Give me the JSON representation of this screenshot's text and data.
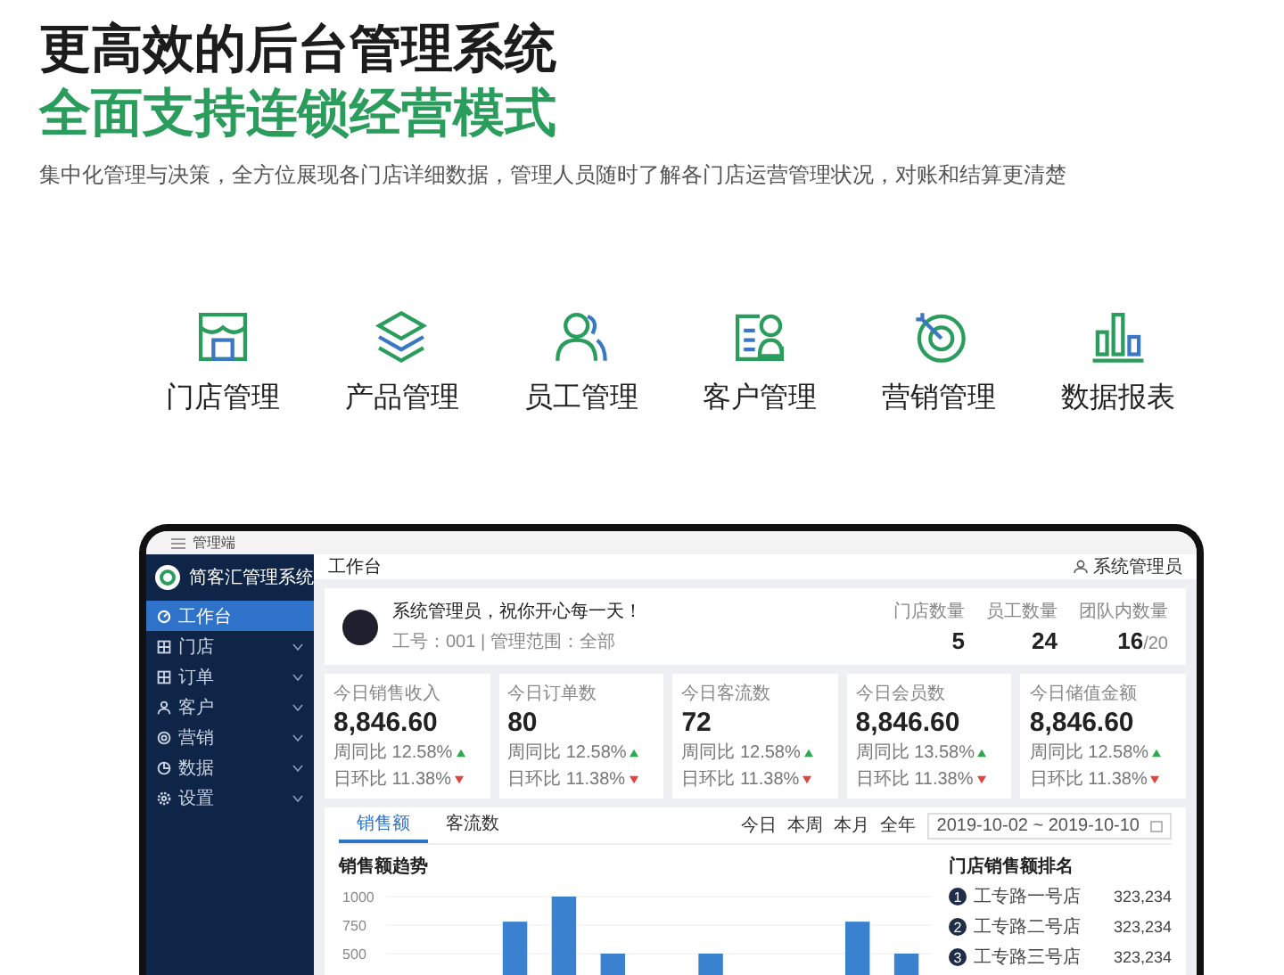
{
  "hero": {
    "title": "更高效的后台管理系统",
    "subtitle": "全面支持连锁经营模式",
    "description": "集中化管理与决策，全方位展现各门店详细数据，管理人员随时了解各门店运营管理状况，对账和结算更清楚"
  },
  "features": [
    {
      "label": "门店管理",
      "kind": "store"
    },
    {
      "label": "产品管理",
      "kind": "layers"
    },
    {
      "label": "员工管理",
      "kind": "people"
    },
    {
      "label": "客户管理",
      "kind": "card"
    },
    {
      "label": "营销管理",
      "kind": "target"
    },
    {
      "label": "数据报表",
      "kind": "bars"
    }
  ],
  "app": {
    "window_title": "管理端",
    "brand": "简客汇管理系统",
    "page_title": "工作台",
    "user": "系统管理员",
    "sidebar": [
      {
        "label": "工作台",
        "kind": "dashboard",
        "selected": true,
        "expandable": false
      },
      {
        "label": "门店",
        "kind": "grid",
        "selected": false,
        "expandable": true
      },
      {
        "label": "订单",
        "kind": "grid",
        "selected": false,
        "expandable": true
      },
      {
        "label": "客户",
        "kind": "person",
        "selected": false,
        "expandable": true
      },
      {
        "label": "营销",
        "kind": "target",
        "selected": false,
        "expandable": true
      },
      {
        "label": "数据",
        "kind": "pie",
        "selected": false,
        "expandable": true
      },
      {
        "label": "设置",
        "kind": "gear",
        "selected": false,
        "expandable": true
      }
    ],
    "greeting": "系统管理员，祝你开心每一天！",
    "meta": "工号：001 | 管理范围：全部",
    "stats": [
      {
        "label": "门店数量",
        "value": "5"
      },
      {
        "label": "员工数量",
        "value": "24"
      },
      {
        "label": "团队内数量",
        "value": "16",
        "suffix": "/20"
      }
    ],
    "kpis": [
      {
        "label": "今日销售收入",
        "value": "8,846.60",
        "week_label": "周同比",
        "week": "12.58%",
        "week_rising": true,
        "day_label": "日环比",
        "day": "11.38%",
        "day_rising": false
      },
      {
        "label": "今日订单数",
        "value": "80",
        "week_label": "周同比",
        "week": "12.58%",
        "week_rising": true,
        "day_label": "日环比",
        "day": "11.38%",
        "day_rising": false
      },
      {
        "label": "今日客流数",
        "value": "72",
        "week_label": "周同比",
        "week": "12.58%",
        "week_rising": true,
        "day_label": "日环比",
        "day": "11.38%",
        "day_rising": false
      },
      {
        "label": "今日会员数",
        "value": "8,846.60",
        "week_label": "周同比",
        "week": "13.58%",
        "week_rising": true,
        "day_label": "日环比",
        "day": "11.38%",
        "day_rising": false
      },
      {
        "label": "今日储值金额",
        "value": "8,846.60",
        "week_label": "周同比",
        "week": "12.58%",
        "week_rising": true,
        "day_label": "日环比",
        "day": "11.38%",
        "day_rising": false
      }
    ],
    "sales": {
      "tabs": [
        {
          "label": "销售额",
          "selected": true
        },
        {
          "label": "客流数",
          "selected": false
        }
      ],
      "ranges": [
        "今日",
        "本周",
        "本月",
        "全年"
      ],
      "date_range": "2019-10-02 ~ 2019-10-10",
      "chart_title": "销售额趋势",
      "chart_data": {
        "type": "bar",
        "values": [
          null,
          null,
          780,
          1000,
          500,
          null,
          500,
          null,
          null,
          780,
          500
        ],
        "yticks": [
          500,
          750,
          1000
        ],
        "ylim": [
          0,
          1000
        ]
      },
      "ranking_title": "门店销售额排名",
      "ranking": [
        {
          "rank": "1",
          "name": "工专路一号店",
          "value": "323,234"
        },
        {
          "rank": "2",
          "name": "工专路二号店",
          "value": "323,234"
        },
        {
          "rank": "3",
          "name": "工专路三号店",
          "value": "323,234"
        }
      ]
    }
  }
}
